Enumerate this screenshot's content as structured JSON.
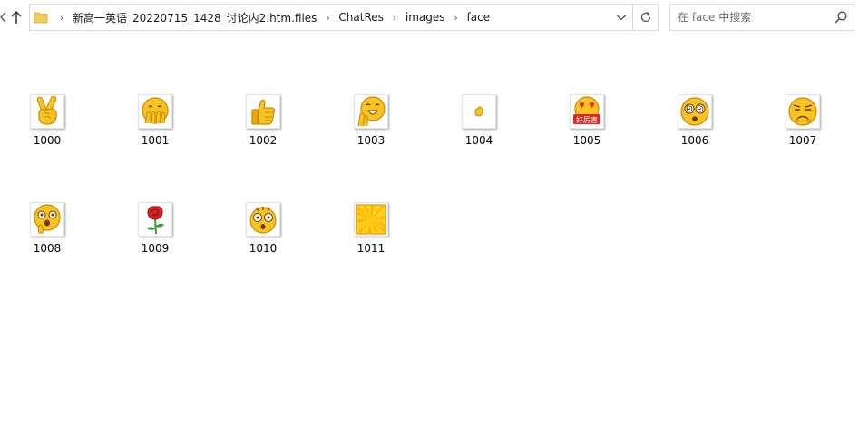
{
  "navigation": {
    "back_icon": "chevron-left-icon",
    "up_icon": "arrow-up-icon"
  },
  "address_bar": {
    "folder_icon": "folder-icon",
    "crumbs": [
      "新高一英语_20220715_1428_讨论内2.htm.files",
      "ChatRes",
      "images",
      "face"
    ],
    "dropdown_icon": "chevron-down-icon",
    "refresh_icon": "refresh-icon"
  },
  "search": {
    "placeholder": "在 face 中搜索",
    "icon": "search-icon"
  },
  "files": [
    {
      "name": "1000",
      "icon": "victory-hand-icon"
    },
    {
      "name": "1001",
      "icon": "covering-mouth-face-icon"
    },
    {
      "name": "1002",
      "icon": "thumbs-up-icon"
    },
    {
      "name": "1003",
      "icon": "cheering-face-icon"
    },
    {
      "name": "1004",
      "icon": "small-hand-icon"
    },
    {
      "name": "1005",
      "icon": "heart-eyes-face-icon",
      "badge": "好厉害"
    },
    {
      "name": "1006",
      "icon": "dizzy-face-icon"
    },
    {
      "name": "1007",
      "icon": "sobbing-face-icon"
    },
    {
      "name": "1008",
      "icon": "shocked-face-icon"
    },
    {
      "name": "1009",
      "icon": "rose-icon"
    },
    {
      "name": "1010",
      "icon": "scared-face-icon"
    },
    {
      "name": "1011",
      "icon": "sunburst-icon"
    }
  ],
  "colors": {
    "emoji_yellow": "#f9c423",
    "emoji_outline": "#c98a00",
    "rose_red": "#d4262a",
    "stem_green": "#3a9a34",
    "badge_red": "#d8281f"
  }
}
